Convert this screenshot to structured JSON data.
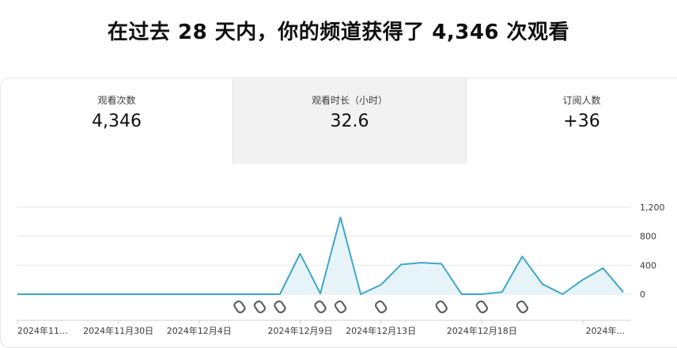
{
  "headline": "在过去 28 天内，你的频道获得了 4,346 次观看",
  "metrics": [
    {
      "label": "观看次数",
      "value": "4,346"
    },
    {
      "label": "观看时长（小时）",
      "value": "32.6"
    },
    {
      "label": "订阅人数",
      "value": "+36"
    }
  ],
  "chart_data": {
    "type": "area",
    "series": [
      {
        "values": [
          0,
          0,
          0,
          0,
          0,
          0,
          0,
          0,
          0,
          0,
          0,
          0,
          0,
          0,
          560,
          10,
          1060,
          0,
          130,
          410,
          435,
          420,
          0,
          0,
          30,
          520,
          140,
          0,
          200,
          360,
          30
        ]
      }
    ],
    "ylim": [
      0,
      1200
    ],
    "y_ticks": [
      "1,200",
      "800",
      "400",
      "0"
    ],
    "y_tick_values": [
      1200,
      800,
      400,
      0
    ],
    "x_ticks": [
      {
        "index": 0,
        "label": "2024年11..."
      },
      {
        "index": 5,
        "label": "2024年11月30日"
      },
      {
        "index": 9,
        "label": "2024年12月4日"
      },
      {
        "index": 14,
        "label": "2024年12月9日"
      },
      {
        "index": 18,
        "label": "2024年12月13日"
      },
      {
        "index": 23,
        "label": "2024年12月18日"
      },
      {
        "index": 28,
        "label": "2024年..."
      }
    ],
    "shorts_markers": [
      11,
      12,
      13,
      15,
      16,
      18,
      21,
      23,
      25
    ],
    "line_color": "#3ea6c8",
    "fill_color": "#e6f4fa",
    "grid": true
  }
}
